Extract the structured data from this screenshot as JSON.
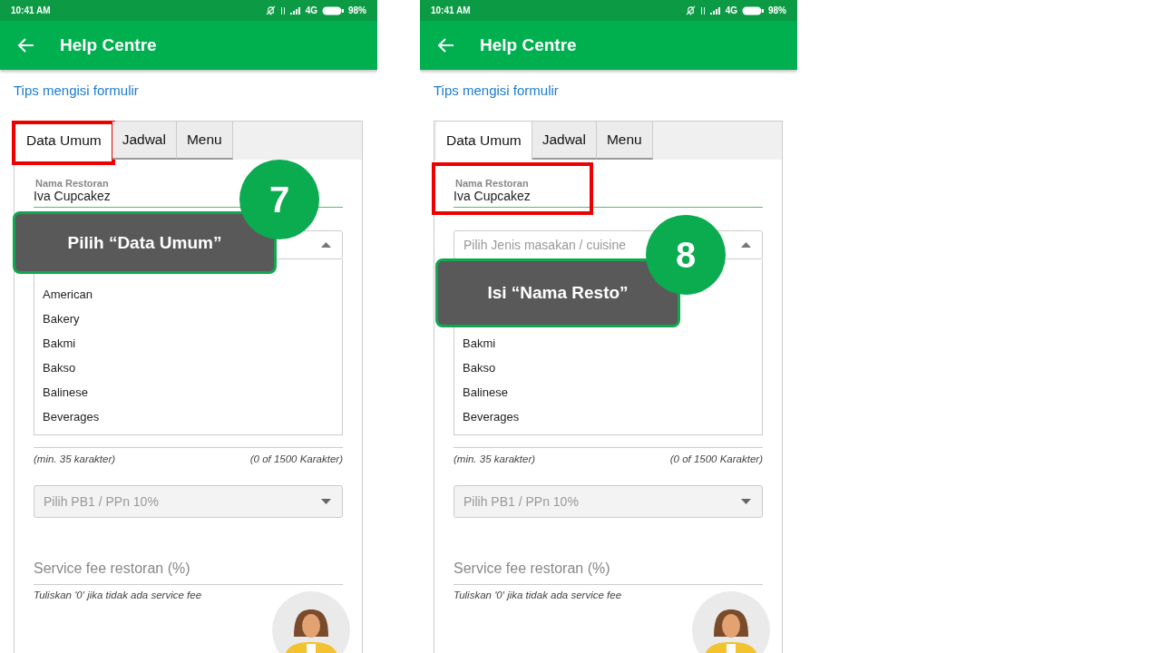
{
  "phones": [
    {
      "status_bar": {
        "time": "10:41 AM",
        "network": "4G",
        "battery": "98%"
      },
      "app_bar": {
        "title": "Help Centre"
      },
      "tips_link": "Tips mengisi formulir",
      "tabs": [
        {
          "label": "Data Umum",
          "selected": true,
          "highlighted": true
        },
        {
          "label": "Jadwal",
          "selected": false,
          "highlighted": false
        },
        {
          "label": "Menu",
          "selected": false,
          "highlighted": false
        }
      ],
      "form": {
        "name_label": "Nama Restoran",
        "name_value": "Iva Cupcakez",
        "name_highlighted": false,
        "cuisine_options": [
          {
            "label": "American",
            "selected": false
          },
          {
            "label": "Bakery",
            "selected": false
          },
          {
            "label": "Bakmi",
            "selected": false
          },
          {
            "label": "Bakso",
            "selected": false
          },
          {
            "label": "Balinese",
            "selected": false
          },
          {
            "label": "Beverages",
            "selected": false
          }
        ],
        "char_min": "(min. 35 karakter)",
        "char_count": "(0 of 1500 Karakter)",
        "tax_placeholder": "Pilih PB1 / PPn 10%",
        "service_fee_placeholder": "Service fee restoran (%)",
        "service_fee_hint": "Tuliskan '0' jika tidak ada service fee"
      },
      "callout": {
        "number": "7",
        "text": "Pilih “Data Umum”"
      }
    },
    {
      "status_bar": {
        "time": "10:41 AM",
        "network": "4G",
        "battery": "98%"
      },
      "app_bar": {
        "title": "Help Centre"
      },
      "tips_link": "Tips mengisi formulir",
      "tabs": [
        {
          "label": "Data Umum",
          "selected": true,
          "highlighted": false
        },
        {
          "label": "Jadwal",
          "selected": false,
          "highlighted": false
        },
        {
          "label": "Menu",
          "selected": false,
          "highlighted": false
        }
      ],
      "form": {
        "name_label": "Nama Restoran",
        "name_value": "Iva Cupcakez",
        "name_highlighted": true,
        "cuisine_placeholder": "Pilih Jenis masakan / cuisine",
        "cuisine_options": [
          {
            "label": "Bakmi",
            "selected": false
          },
          {
            "label": "Bakso",
            "selected": false
          },
          {
            "label": "Balinese",
            "selected": false
          },
          {
            "label": "Beverages",
            "selected": false
          }
        ],
        "char_min": "(min. 35 karakter)",
        "char_count": "(0 of 1500 Karakter)",
        "tax_placeholder": "Pilih PB1 / PPn 10%",
        "service_fee_placeholder": "Service fee restoran (%)",
        "service_fee_hint": "Tuliskan '0' jika tidak ada service fee"
      },
      "callout": {
        "number": "8",
        "text": "Isi “Nama Resto”"
      }
    }
  ]
}
